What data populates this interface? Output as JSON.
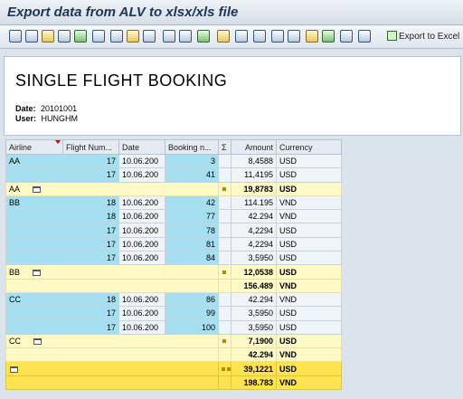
{
  "window": {
    "title": "Export data from ALV to xlsx/xls file"
  },
  "toolbar": {
    "icons": [
      "details-icon",
      "select-all-icon",
      "refresh-icon",
      "print-preview-icon",
      "document-icon",
      "print-icon",
      "sort-ascending-icon",
      "filter-icon",
      "filter-set-icon",
      "sum-icon",
      "subtotal-icon",
      "layout-icon",
      "mail-icon",
      "export-icon",
      "word-icon",
      "graphic-icon",
      "abc-analysis-icon",
      "change-layout-icon",
      "choose-layout-icon",
      "save-layout-icon",
      "info-icon"
    ],
    "export_label": "Export to Excel"
  },
  "header": {
    "report_title": "SINGLE FLIGHT BOOKING",
    "date_label": "Date:",
    "date_value": "20101001",
    "user_label": "User:",
    "user_value": "HUNGHM"
  },
  "grid": {
    "columns": [
      "Airline",
      "Flight Num...",
      "Date",
      "Booking n...",
      "Σ",
      "Amount",
      "Currency"
    ],
    "rows": [
      {
        "type": "data",
        "airline": "AA",
        "flight": "17",
        "date": "10.06.200",
        "booking": "3",
        "amount": "8,4588",
        "currency": "USD"
      },
      {
        "type": "data",
        "airline": "",
        "flight": "17",
        "date": "10.06.200",
        "booking": "41",
        "amount": "11,4195",
        "currency": "USD"
      },
      {
        "type": "sub",
        "airline": "AA",
        "amount": "19,8783",
        "currency": "USD"
      },
      {
        "type": "data",
        "airline": "BB",
        "flight": "18",
        "date": "10.06.200",
        "booking": "42",
        "amount": "114.195",
        "currency": "VND"
      },
      {
        "type": "data",
        "airline": "",
        "flight": "18",
        "date": "10.06.200",
        "booking": "77",
        "amount": "42.294",
        "currency": "VND"
      },
      {
        "type": "data",
        "airline": "",
        "flight": "17",
        "date": "10.06.200",
        "booking": "78",
        "amount": "4,2294",
        "currency": "USD"
      },
      {
        "type": "data",
        "airline": "",
        "flight": "17",
        "date": "10.06.200",
        "booking": "81",
        "amount": "4,2294",
        "currency": "USD"
      },
      {
        "type": "data",
        "airline": "",
        "flight": "17",
        "date": "10.06.200",
        "booking": "84",
        "amount": "3,5950",
        "currency": "USD"
      },
      {
        "type": "sub",
        "airline": "BB",
        "amount": "12,0538",
        "currency": "USD"
      },
      {
        "type": "sub2",
        "amount": "156.489",
        "currency": "VND"
      },
      {
        "type": "data",
        "airline": "CC",
        "flight": "18",
        "date": "10.06.200",
        "booking": "86",
        "amount": "42.294",
        "currency": "VND"
      },
      {
        "type": "data",
        "airline": "",
        "flight": "17",
        "date": "10.06.200",
        "booking": "99",
        "amount": "3,5950",
        "currency": "USD"
      },
      {
        "type": "data",
        "airline": "",
        "flight": "17",
        "date": "10.06.200",
        "booking": "100",
        "amount": "3,5950",
        "currency": "USD"
      },
      {
        "type": "sub",
        "airline": "CC",
        "amount": "7,1900",
        "currency": "USD"
      },
      {
        "type": "sub2",
        "amount": "42.294",
        "currency": "VND"
      },
      {
        "type": "tot",
        "amount": "39,1221",
        "currency": "USD"
      },
      {
        "type": "tot2",
        "amount": "198.783",
        "currency": "VND"
      }
    ]
  },
  "colors": {
    "group_cell": "#a5dff0",
    "subtotal_row": "#fff9c6",
    "total_row": "#ffe34f"
  }
}
